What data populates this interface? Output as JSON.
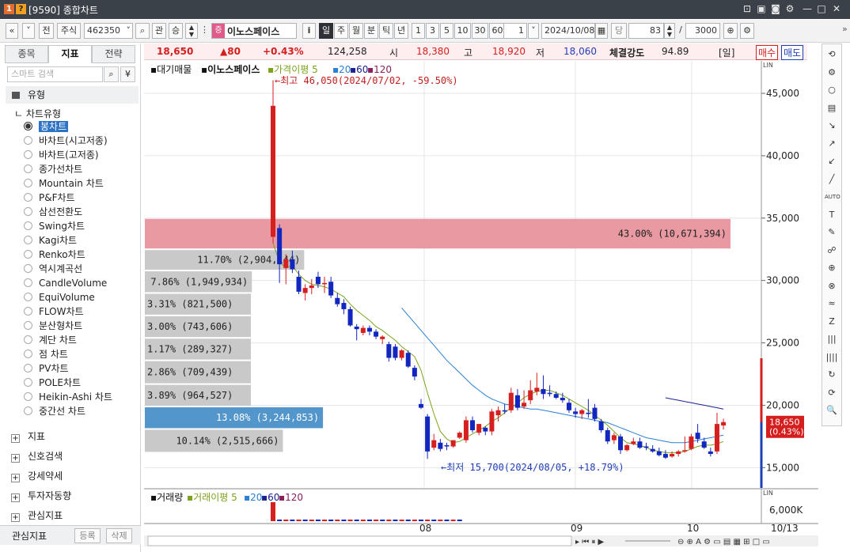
{
  "window": {
    "title": "[9590] 종합차트",
    "icons": [
      "app-icon",
      "info-icon"
    ],
    "buttons": [
      "⊡",
      "▣",
      "◙",
      "⚙",
      "—",
      "□",
      "✕"
    ]
  },
  "toolbar": {
    "prev_label": "«",
    "next_label": "»",
    "jeon_label": "전",
    "market_label": "주식",
    "code_value": "462350",
    "kwan_label": "관",
    "sang_label": "승",
    "stock_badge": "증",
    "stock_name": "이노스페이스",
    "info_label": "i",
    "periods": [
      "일",
      "주",
      "월",
      "분",
      "틱",
      "년"
    ],
    "minutes": [
      "1",
      "3",
      "5",
      "10",
      "30",
      "60"
    ],
    "interval_value": "1",
    "date_value": "2024/10/08",
    "dang_label": "당",
    "count_value": "83",
    "slash": "/",
    "total_value": "3000"
  },
  "left_panel": {
    "tabs": [
      "종목",
      "지표",
      "전략"
    ],
    "search_placeholder": "스마트 검색",
    "section_label": "유형",
    "tree_root": "차트유형",
    "chart_types": [
      "봉차트",
      "바차트(시고저종)",
      "바차트(고저종)",
      "종가선차트",
      "Mountain 차트",
      "P&F차트",
      "삼선전환도",
      "Swing차트",
      "Kagi차트",
      "Renko차트",
      "역시계곡선",
      "CandleVolume",
      "EquiVolume",
      "FLOW차트",
      "분산형차트",
      "계단 차트",
      "점 차트",
      "PV차트",
      "POLE차트",
      "Heikin-Ashi 차트",
      "중간선 차트"
    ],
    "groups": [
      "지표",
      "신호검색",
      "강세약세",
      "투자자동향",
      "관심지표"
    ],
    "bottom_label": "관심지표",
    "register_label": "등록",
    "delete_label": "삭제"
  },
  "price_bar": {
    "price": "18,650",
    "change": "▲80",
    "change_pct": "+0.43%",
    "volume": "124,258",
    "open_label": "시",
    "open": "18,380",
    "high_label": "고",
    "high": "18,920",
    "low_label": "저",
    "low": "18,060",
    "strength_label": "체결강도",
    "strength": "94.89",
    "period_tag": "[일]",
    "buy_label": "매수",
    "sell_label": "매도"
  },
  "chart_data": {
    "type": "candlestick",
    "title": "대기매물",
    "stock": "이노스페이스",
    "ma_label": "가격이평 5",
    "ma_periods": [
      "20",
      "60",
      "120"
    ],
    "y_ticks": [
      45000,
      40000,
      35000,
      30000,
      25000,
      20000,
      15000
    ],
    "y_tick_labels": [
      "45,000",
      "40,000",
      "35,000",
      "30,000",
      "25,000",
      "20,000",
      "15,000"
    ],
    "ylim": [
      13500,
      47600
    ],
    "x_labels": [
      "08",
      "09",
      "10"
    ],
    "candles": [
      {
        "open": 33500,
        "high": 46050,
        "low": 33000,
        "close": 44000
      },
      {
        "open": 34200,
        "high": 34500,
        "low": 29800,
        "close": 31300
      },
      {
        "open": 31000,
        "high": 32100,
        "low": 29700,
        "close": 31700
      },
      {
        "open": 31700,
        "high": 32400,
        "low": 30600,
        "close": 30900
      },
      {
        "open": 30300,
        "high": 30800,
        "low": 28900,
        "close": 29100
      },
      {
        "open": 29000,
        "high": 29700,
        "low": 28400,
        "close": 29400
      },
      {
        "open": 29400,
        "high": 30100,
        "low": 28900,
        "close": 29600
      },
      {
        "open": 30300,
        "high": 30700,
        "low": 29400,
        "close": 29700
      },
      {
        "open": 29700,
        "high": 30300,
        "low": 29000,
        "close": 29800
      },
      {
        "open": 29900,
        "high": 30300,
        "low": 28600,
        "close": 28800
      },
      {
        "open": 28600,
        "high": 29000,
        "low": 27900,
        "close": 28100
      },
      {
        "open": 28200,
        "high": 28500,
        "low": 27300,
        "close": 27700
      },
      {
        "open": 27700,
        "high": 27900,
        "low": 26300,
        "close": 26400
      },
      {
        "open": 26300,
        "high": 26500,
        "low": 25200,
        "close": 26100
      },
      {
        "open": 25800,
        "high": 26400,
        "low": 25600,
        "close": 26200
      },
      {
        "open": 26200,
        "high": 26400,
        "low": 25600,
        "close": 25900
      },
      {
        "open": 25900,
        "high": 26100,
        "low": 25300,
        "close": 25500
      },
      {
        "open": 25300,
        "high": 25600,
        "low": 24900,
        "close": 25500
      },
      {
        "open": 24900,
        "high": 25100,
        "low": 23500,
        "close": 23800
      },
      {
        "open": 24700,
        "high": 24900,
        "low": 23600,
        "close": 23800
      },
      {
        "open": 23800,
        "high": 24500,
        "low": 23600,
        "close": 24400
      },
      {
        "open": 24200,
        "high": 24400,
        "low": 23000,
        "close": 23100
      },
      {
        "open": 23000,
        "high": 23200,
        "low": 22000,
        "close": 22300
      },
      {
        "open": 20100,
        "high": 20500,
        "low": 19700,
        "close": 19800
      },
      {
        "open": 19100,
        "high": 19300,
        "low": 15700,
        "close": 16300
      },
      {
        "open": 16600,
        "high": 17700,
        "low": 16400,
        "close": 17200
      },
      {
        "open": 17000,
        "high": 17300,
        "low": 16300,
        "close": 16500
      },
      {
        "open": 16800,
        "high": 17000,
        "low": 16400,
        "close": 16700
      },
      {
        "open": 16700,
        "high": 17200,
        "low": 16600,
        "close": 17200
      },
      {
        "open": 17400,
        "high": 17900,
        "low": 17300,
        "close": 17800
      },
      {
        "open": 17200,
        "high": 19100,
        "low": 17000,
        "close": 18800
      },
      {
        "open": 18800,
        "high": 19100,
        "low": 17800,
        "close": 18000
      },
      {
        "open": 17800,
        "high": 18500,
        "low": 17600,
        "close": 18500
      },
      {
        "open": 18200,
        "high": 18300,
        "low": 17600,
        "close": 17900
      },
      {
        "open": 17900,
        "high": 19700,
        "low": 17600,
        "close": 19500
      },
      {
        "open": 19200,
        "high": 19900,
        "low": 18700,
        "close": 19600
      },
      {
        "open": 19600,
        "high": 20100,
        "low": 19300,
        "close": 19500
      },
      {
        "open": 19600,
        "high": 21400,
        "low": 19400,
        "close": 21000
      },
      {
        "open": 20800,
        "high": 21300,
        "low": 19600,
        "close": 19800
      },
      {
        "open": 19900,
        "high": 21200,
        "low": 19700,
        "close": 20200
      },
      {
        "open": 20400,
        "high": 22000,
        "low": 20100,
        "close": 21200
      },
      {
        "open": 21100,
        "high": 22600,
        "low": 20800,
        "close": 21400
      },
      {
        "open": 21300,
        "high": 22400,
        "low": 20500,
        "close": 20900
      },
      {
        "open": 21000,
        "high": 21600,
        "low": 20700,
        "close": 20900
      },
      {
        "open": 20900,
        "high": 21100,
        "low": 20500,
        "close": 20600
      },
      {
        "open": 20600,
        "high": 21000,
        "low": 20200,
        "close": 20400
      },
      {
        "open": 20200,
        "high": 20500,
        "low": 19400,
        "close": 19600
      },
      {
        "open": 19500,
        "high": 19800,
        "low": 19000,
        "close": 19300
      },
      {
        "open": 19300,
        "high": 19700,
        "low": 18900,
        "close": 19600
      },
      {
        "open": 19400,
        "high": 20500,
        "low": 19000,
        "close": 19300
      },
      {
        "open": 19800,
        "high": 20100,
        "low": 18700,
        "close": 18900
      },
      {
        "open": 18700,
        "high": 18900,
        "low": 17800,
        "close": 18000
      },
      {
        "open": 18000,
        "high": 18200,
        "low": 16900,
        "close": 17100
      },
      {
        "open": 17200,
        "high": 17800,
        "low": 16900,
        "close": 17600
      },
      {
        "open": 17500,
        "high": 17700,
        "low": 16100,
        "close": 16400
      },
      {
        "open": 16400,
        "high": 16900,
        "low": 16300,
        "close": 16800
      },
      {
        "open": 16900,
        "high": 17400,
        "low": 16800,
        "close": 17100
      },
      {
        "open": 17100,
        "high": 17400,
        "low": 16500,
        "close": 16600
      },
      {
        "open": 16700,
        "high": 17000,
        "low": 16400,
        "close": 16600
      },
      {
        "open": 16500,
        "high": 16800,
        "low": 16200,
        "close": 16300
      },
      {
        "open": 16300,
        "high": 16600,
        "low": 15900,
        "close": 16000
      },
      {
        "open": 16100,
        "high": 16400,
        "low": 15700,
        "close": 15800
      },
      {
        "open": 15900,
        "high": 16300,
        "low": 15800,
        "close": 16100
      },
      {
        "open": 16100,
        "high": 16400,
        "low": 15900,
        "close": 16300
      },
      {
        "open": 16300,
        "high": 17500,
        "low": 16200,
        "close": 16400
      },
      {
        "open": 16500,
        "high": 17700,
        "low": 16400,
        "close": 17500
      },
      {
        "open": 17800,
        "high": 18500,
        "low": 17000,
        "close": 17300
      },
      {
        "open": 17100,
        "high": 17400,
        "low": 16500,
        "close": 16600
      },
      {
        "open": 16300,
        "high": 16600,
        "low": 15900,
        "close": 16100
      },
      {
        "open": 16300,
        "high": 19400,
        "low": 16100,
        "close": 18500
      },
      {
        "open": 18380,
        "high": 18920,
        "low": 18060,
        "close": 18650
      }
    ],
    "ma5": [
      33000,
      31500,
      31000,
      31200,
      30500,
      30000,
      29700,
      29600,
      29500,
      29300,
      29000,
      28700,
      28100,
      27600,
      27200,
      26800,
      26300,
      26000,
      25600,
      25200,
      24700,
      24300,
      23900,
      22800,
      21000,
      19300,
      17900,
      17300,
      17000,
      17100,
      17400,
      17700,
      18000,
      18300,
      18700,
      19000,
      19400,
      19800,
      20200,
      20600,
      20900,
      21100,
      21200,
      21200,
      21000,
      20800,
      20500,
      20200,
      19900,
      19600,
      19200,
      18800,
      18400,
      17900,
      17400,
      17000,
      16900,
      16800,
      16600,
      16400,
      16300,
      16200,
      16200,
      16200,
      16300,
      16500,
      16700,
      16800,
      16800,
      16900,
      17100
    ],
    "ma20_start_index": 20,
    "ma20": [
      27800,
      27200,
      26600,
      26000,
      25400,
      24800,
      24200,
      23600,
      23100,
      22600,
      22100,
      21600,
      21200,
      20800,
      20500,
      20300,
      20100,
      20000,
      19900,
      19800,
      19700,
      19700,
      19600,
      19500,
      19400,
      19300,
      19200,
      19100,
      19000,
      18900,
      18800,
      18700,
      18600,
      18400,
      18200,
      18000,
      17800,
      17600,
      17400,
      17300,
      17200,
      17100,
      17000,
      17000,
      17000,
      17100,
      17200,
      17300,
      17400,
      17500,
      17600
    ],
    "ma60_start_index": 61,
    "ma60": [
      20600,
      20500,
      20400,
      20300,
      20200,
      20100,
      20000,
      19900,
      19800,
      19700
    ],
    "volume_profile": [
      {
        "price_low": 32500,
        "price_high": 35000,
        "pct": "43.00%",
        "qty": "10,671,394",
        "share": 43.0,
        "highlight": "max"
      },
      {
        "price_low": 30800,
        "price_high": 32500,
        "pct": "11.70%",
        "qty": "2,904,144",
        "share": 11.7
      },
      {
        "price_low": 29000,
        "price_high": 30800,
        "pct": "7.86%",
        "qty": "1,949,934",
        "share": 7.86
      },
      {
        "price_low": 27200,
        "price_high": 29000,
        "pct": "3.31%",
        "qty": "821,500",
        "share": 3.31
      },
      {
        "price_low": 25400,
        "price_high": 27200,
        "pct": "3.00%",
        "qty": "743,606",
        "share": 3.0
      },
      {
        "price_low": 23600,
        "price_high": 25400,
        "pct": "1.17%",
        "qty": "289,327",
        "share": 1.17
      },
      {
        "price_low": 21700,
        "price_high": 23600,
        "pct": "2.86%",
        "qty": "709,439",
        "share": 2.86
      },
      {
        "price_low": 19900,
        "price_high": 21700,
        "pct": "3.89%",
        "qty": "964,527",
        "share": 3.89
      },
      {
        "price_low": 18100,
        "price_high": 19900,
        "pct": "13.08%",
        "qty": "3,244,853",
        "share": 13.08,
        "highlight": "current"
      },
      {
        "price_low": 16200,
        "price_high": 18100,
        "pct": "10.14%",
        "qty": "2,515,666",
        "share": 10.14
      }
    ],
    "annotations": {
      "high": "최고 46,050(2024/07/02, -59.50%)",
      "low": "최저 15,700(2024/08/05, +18.79%)",
      "current_price": "18,650",
      "current_pct": "(0.43%)"
    },
    "volume_panel": {
      "title": "거래량",
      "ma_label": "거래이평 5",
      "ma_periods": [
        "20",
        "60",
        "120"
      ],
      "y_tick_label": "6,000K",
      "x_end_label": "10/13"
    },
    "colors": {
      "up": "#d61f1f",
      "down": "#1226c0",
      "ma5": "#7aa21c",
      "ma20": "#2a7fd6",
      "ma60": "#1a2190",
      "max_band": "#e8949c",
      "current_band": "#4a90c8",
      "band": "#c6c6c6"
    }
  },
  "right_tools": [
    "⟲",
    "⚙",
    "○",
    "▤",
    "↘",
    "↗",
    "↙",
    "╱",
    "AUTO",
    "T",
    "✎",
    "☍",
    "⊕",
    "⊗",
    "≈",
    "Z",
    "|||",
    "||||",
    "↻",
    "⟳",
    "🔍"
  ]
}
